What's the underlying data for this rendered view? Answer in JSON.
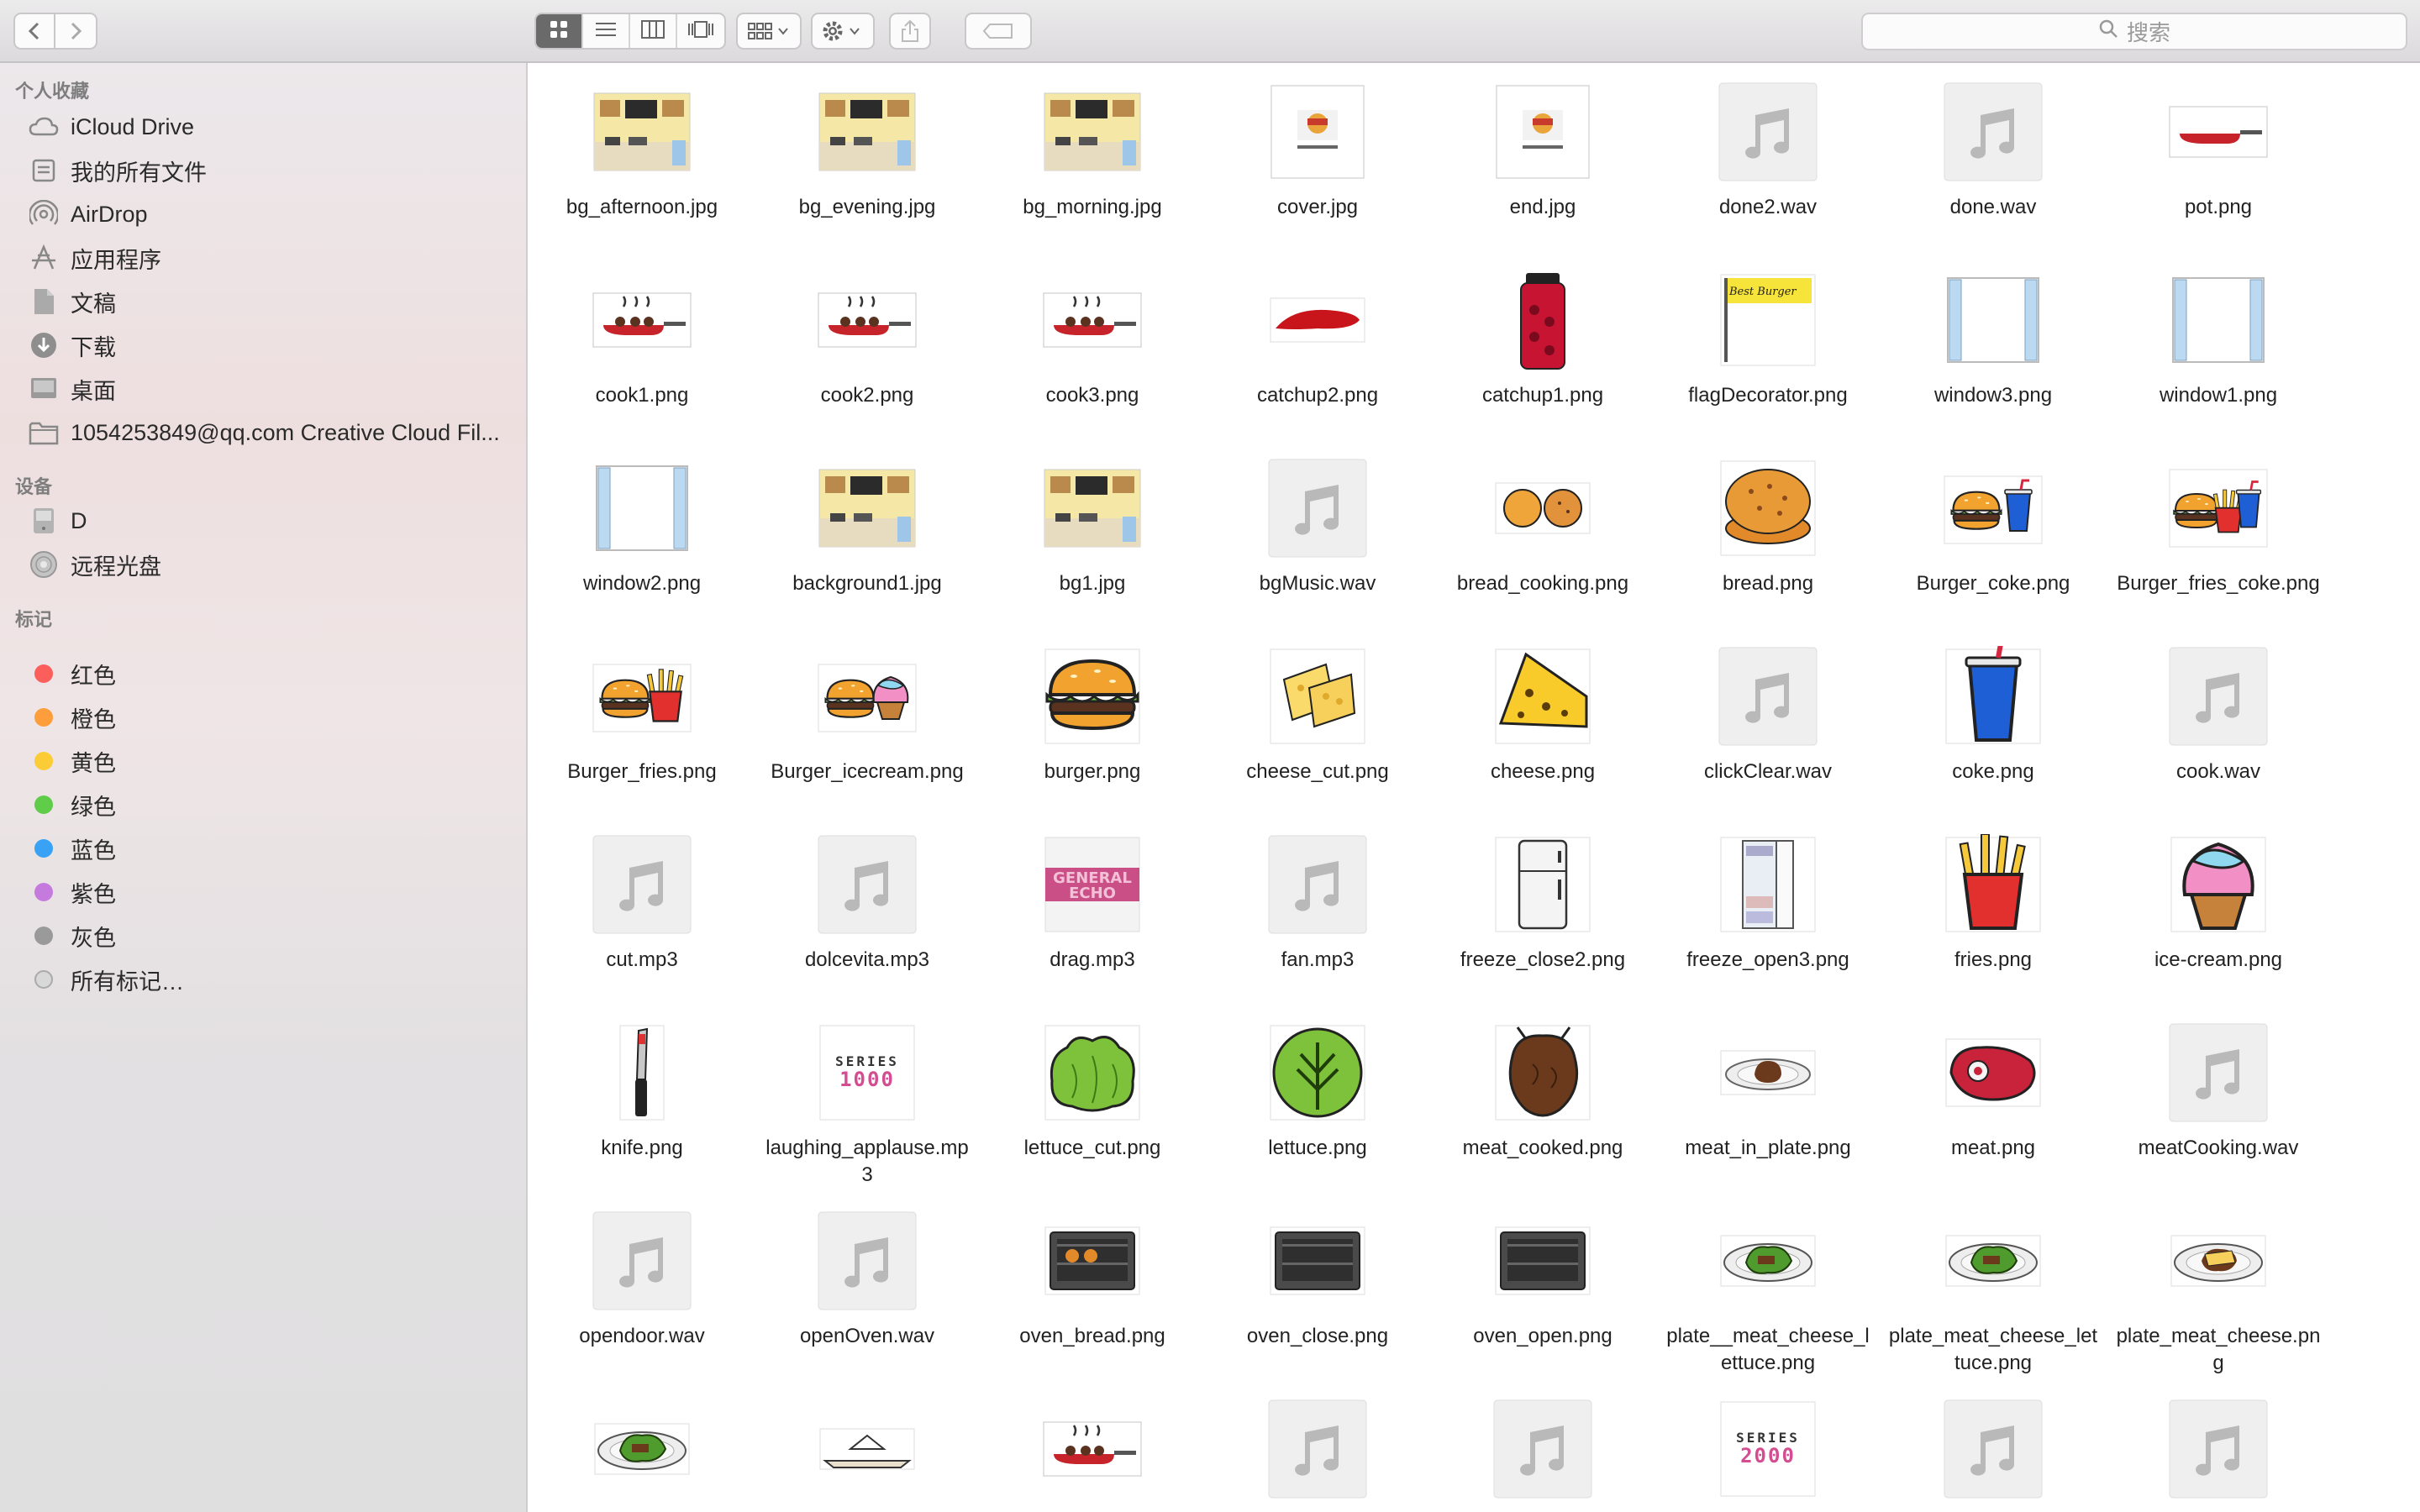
{
  "toolbar": {
    "search_placeholder": "搜索",
    "icons": [
      "back-icon",
      "forward-icon",
      "icon-view-icon",
      "list-view-icon",
      "column-view-icon",
      "cover-flow-icon",
      "group-icon",
      "gear-icon",
      "share-icon",
      "tag-icon"
    ]
  },
  "sidebar": {
    "favorites_header": "个人收藏",
    "favorites": [
      {
        "label": "iCloud Drive",
        "icon": "cloud-icon"
      },
      {
        "label": "我的所有文件",
        "icon": "all-files-icon"
      },
      {
        "label": "AirDrop",
        "icon": "airdrop-icon"
      },
      {
        "label": "应用程序",
        "icon": "applications-icon"
      },
      {
        "label": "文稿",
        "icon": "documents-icon"
      },
      {
        "label": "下载",
        "icon": "downloads-icon"
      },
      {
        "label": "桌面",
        "icon": "desktop-icon"
      },
      {
        "label": "1054253849@qq.com Creative Cloud Fil...",
        "icon": "folder-icon"
      }
    ],
    "devices_header": "设备",
    "devices": [
      {
        "label": "D",
        "icon": "drive-icon"
      },
      {
        "label": "远程光盘",
        "icon": "disc-icon"
      }
    ],
    "tags_header": "标记",
    "tags": [
      {
        "label": "红色",
        "color": "#fc5e5b"
      },
      {
        "label": "橙色",
        "color": "#fd9d3b"
      },
      {
        "label": "黄色",
        "color": "#fbcc35"
      },
      {
        "label": "绿色",
        "color": "#5fcc4a"
      },
      {
        "label": "蓝色",
        "color": "#3aa2f4"
      },
      {
        "label": "紫色",
        "color": "#c57bde"
      },
      {
        "label": "灰色",
        "color": "#9a9a9a"
      },
      {
        "label": "所有标记…",
        "color": "#d8d8d8"
      }
    ]
  },
  "files": [
    {
      "name": "bg_afternoon.jpg",
      "kind": "kitchen"
    },
    {
      "name": "bg_evening.jpg",
      "kind": "kitchen"
    },
    {
      "name": "bg_morning.jpg",
      "kind": "kitchen"
    },
    {
      "name": "cover.jpg",
      "kind": "doc"
    },
    {
      "name": "end.jpg",
      "kind": "doc"
    },
    {
      "name": "done2.wav",
      "kind": "audio"
    },
    {
      "name": "done.wav",
      "kind": "audio"
    },
    {
      "name": "pot.png",
      "kind": "pan"
    },
    {
      "name": "cook1.png",
      "kind": "pan-cook"
    },
    {
      "name": "cook2.png",
      "kind": "pan-cook"
    },
    {
      "name": "cook3.png",
      "kind": "pan-cook"
    },
    {
      "name": "catchup2.png",
      "kind": "ketchup-splat"
    },
    {
      "name": "catchup1.png",
      "kind": "ketchup-bottle"
    },
    {
      "name": "flagDecorator.png",
      "kind": "flag"
    },
    {
      "name": "window3.png",
      "kind": "window"
    },
    {
      "name": "window1.png",
      "kind": "window"
    },
    {
      "name": "window2.png",
      "kind": "window"
    },
    {
      "name": "background1.jpg",
      "kind": "kitchen"
    },
    {
      "name": "bg1.jpg",
      "kind": "kitchen"
    },
    {
      "name": "bgMusic.wav",
      "kind": "audio"
    },
    {
      "name": "bread_cooking.png",
      "kind": "bread-cooking"
    },
    {
      "name": "bread.png",
      "kind": "bread"
    },
    {
      "name": "Burger_coke.png",
      "kind": "burger-coke"
    },
    {
      "name": "Burger_fries_coke.png",
      "kind": "burger-fries-coke"
    },
    {
      "name": "Burger_fries.png",
      "kind": "burger-fries"
    },
    {
      "name": "Burger_icecream.png",
      "kind": "burger-icecream"
    },
    {
      "name": "burger.png",
      "kind": "burger"
    },
    {
      "name": "cheese_cut.png",
      "kind": "cheese-cut"
    },
    {
      "name": "cheese.png",
      "kind": "cheese"
    },
    {
      "name": "clickClear.wav",
      "kind": "audio"
    },
    {
      "name": "coke.png",
      "kind": "coke"
    },
    {
      "name": "cook.wav",
      "kind": "audio"
    },
    {
      "name": "cut.mp3",
      "kind": "audio"
    },
    {
      "name": "dolcevita.mp3",
      "kind": "audio"
    },
    {
      "name": "drag.mp3",
      "kind": "album"
    },
    {
      "name": "fan.mp3",
      "kind": "audio"
    },
    {
      "name": "freeze_close2.png",
      "kind": "fridge"
    },
    {
      "name": "freeze_open3.png",
      "kind": "fridge-open"
    },
    {
      "name": "fries.png",
      "kind": "fries"
    },
    {
      "name": "ice-cream.png",
      "kind": "icecream"
    },
    {
      "name": "knife.png",
      "kind": "knife"
    },
    {
      "name": "laughing_applause.mp3",
      "kind": "series",
      "series_text": [
        "SERIES",
        "1000"
      ]
    },
    {
      "name": "lettuce_cut.png",
      "kind": "lettuce-cut"
    },
    {
      "name": "lettuce.png",
      "kind": "lettuce"
    },
    {
      "name": "meat_cooked.png",
      "kind": "meat-cooked"
    },
    {
      "name": "meat_in_plate.png",
      "kind": "meat-plate"
    },
    {
      "name": "meat.png",
      "kind": "meat"
    },
    {
      "name": "meatCooking.wav",
      "kind": "audio"
    },
    {
      "name": "opendoor.wav",
      "kind": "audio"
    },
    {
      "name": "openOven.wav",
      "kind": "audio"
    },
    {
      "name": "oven_bread.png",
      "kind": "oven-bread"
    },
    {
      "name": "oven_close.png",
      "kind": "oven"
    },
    {
      "name": "oven_open.png",
      "kind": "oven"
    },
    {
      "name": "plate__meat_cheese_lettuce.png",
      "kind": "plate-lettuce"
    },
    {
      "name": "plate_meat_cheese_lettuce.png",
      "kind": "plate-lettuce"
    },
    {
      "name": "plate_meat_cheese.png",
      "kind": "plate-cheese"
    },
    {
      "name": "",
      "kind": "plate-lettuce-big"
    },
    {
      "name": "",
      "kind": "plate-empty"
    },
    {
      "name": "",
      "kind": "pan-cook"
    },
    {
      "name": "",
      "kind": "audio"
    },
    {
      "name": "",
      "kind": "audio"
    },
    {
      "name": "",
      "kind": "series",
      "series_text": [
        "SERIES",
        "2000"
      ]
    },
    {
      "name": "",
      "kind": "audio"
    },
    {
      "name": "",
      "kind": "audio"
    }
  ],
  "thumb_labels": {
    "flag": "Best Burger",
    "album": "GENERAL ECHO"
  }
}
